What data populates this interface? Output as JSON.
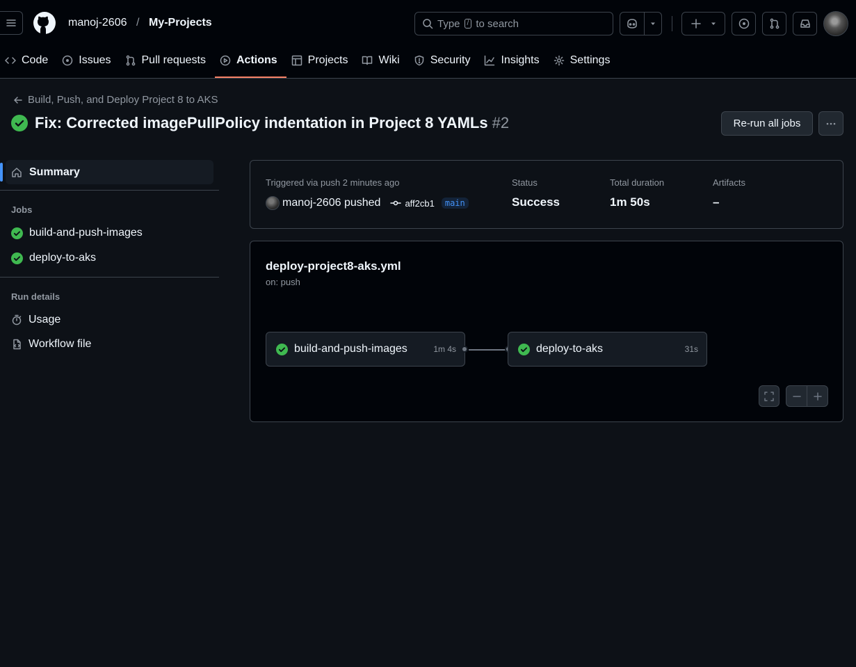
{
  "header": {
    "owner": "manoj-2606",
    "separator": "/",
    "repo": "My-Projects",
    "search_prefix": "Type",
    "search_key": "/",
    "search_suffix": "to search"
  },
  "tabs": [
    {
      "label": "Code",
      "icon": "code-icon",
      "active": false
    },
    {
      "label": "Issues",
      "icon": "issue-icon",
      "active": false
    },
    {
      "label": "Pull requests",
      "icon": "pull-request-icon",
      "active": false
    },
    {
      "label": "Actions",
      "icon": "play-icon",
      "active": true
    },
    {
      "label": "Projects",
      "icon": "table-icon",
      "active": false
    },
    {
      "label": "Wiki",
      "icon": "book-icon",
      "active": false
    },
    {
      "label": "Security",
      "icon": "shield-icon",
      "active": false
    },
    {
      "label": "Insights",
      "icon": "graph-icon",
      "active": false
    },
    {
      "label": "Settings",
      "icon": "gear-icon",
      "active": false
    }
  ],
  "run": {
    "breadcrumb": "Build, Push, and Deploy Project 8 to AKS",
    "title": "Fix: Corrected imagePullPolicy indentation in Project 8 YAMLs",
    "number": "#2",
    "rerun_label": "Re-run all jobs"
  },
  "sidebar": {
    "summary_label": "Summary",
    "jobs_heading": "Jobs",
    "jobs": [
      {
        "label": "build-and-push-images",
        "status": "success"
      },
      {
        "label": "deploy-to-aks",
        "status": "success"
      }
    ],
    "run_details_heading": "Run details",
    "details": [
      {
        "label": "Usage",
        "icon": "stopwatch-icon"
      },
      {
        "label": "Workflow file",
        "icon": "file-code-icon"
      }
    ]
  },
  "summary": {
    "triggered_label": "Triggered via push 2 minutes ago",
    "pusher": "manoj-2606 pushed",
    "commit": "aff2cb1",
    "branch": "main",
    "status_label": "Status",
    "status_value": "Success",
    "duration_label": "Total duration",
    "duration_value": "1m 50s",
    "artifacts_label": "Artifacts",
    "artifacts_value": "–"
  },
  "workflow": {
    "file": "deploy-project8-aks.yml",
    "trigger": "on: push",
    "jobs": [
      {
        "name": "build-and-push-images",
        "duration": "1m 4s"
      },
      {
        "name": "deploy-to-aks",
        "duration": "31s"
      }
    ]
  },
  "colors": {
    "success": "#3fb950",
    "accent_underline": "#f78166",
    "link": "#4493f8"
  }
}
